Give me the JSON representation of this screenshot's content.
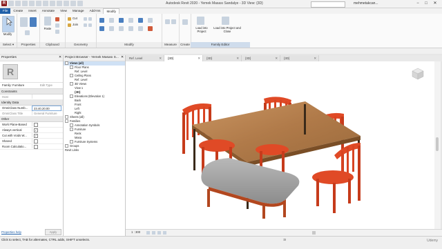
{
  "app": {
    "title": "Autodesk Revit 2020 - Yemek Masası Sandalye - 3D View: {3D}",
    "user": "mehmetakcan...",
    "window_controls": [
      "−",
      "□",
      "✕"
    ]
  },
  "ribbon_tabs": [
    {
      "label": "File"
    },
    {
      "label": "Create"
    },
    {
      "label": "Insert"
    },
    {
      "label": "Annotate"
    },
    {
      "label": "View"
    },
    {
      "label": "Manage"
    },
    {
      "label": "Add-Ins"
    },
    {
      "label": "Modify"
    }
  ],
  "ribbon": {
    "select_panel_label": "Select ▾",
    "modify_button": "Modify",
    "properties_panel_label": "Properties",
    "clipboard_panel_label": "Clipboard",
    "paste_label": "Paste",
    "geometry_panel_label": "Geometry",
    "cut_label": "Cut",
    "join_label": "Join",
    "modify_panel_label": "Modify",
    "measure_panel_label": "Measure",
    "create_panel_label": "Create",
    "load_into_project_label": "Load into Project",
    "load_into_project_close_label": "Load into Project and Close",
    "family_editor_label": "Family Editor"
  },
  "properties": {
    "header": "Properties",
    "close": "✕",
    "type_selector": "Family: Furniture",
    "edit_type": "Edit Type",
    "sections": {
      "constraints": "Constraints",
      "identity": "Identity Data",
      "other": "Other"
    },
    "constraints_rows": [
      {
        "name": "Host",
        "value": ""
      }
    ],
    "identity_rows": [
      {
        "name": "OmniClass Numb...",
        "value": "23.40.20.00"
      },
      {
        "name": "OmniClass Title",
        "value": "General Furniture"
      }
    ],
    "other_rows": [
      {
        "name": "Work Plane-Based",
        "checked": false
      },
      {
        "name": "Always vertical",
        "checked": true
      },
      {
        "name": "Cut with Voids W...",
        "checked": true
      },
      {
        "name": "Shared",
        "checked": false
      },
      {
        "name": "Room Calculatio...",
        "checked": false
      }
    ],
    "help_link": "Properties help",
    "apply_button": "Apply"
  },
  "project_browser": {
    "header": "Project Browser - Yemek Masası S...",
    "close": "✕",
    "items": [
      {
        "label": "Views (all)",
        "level": 0,
        "exp": true,
        "bold": true
      },
      {
        "label": "Floor Plans",
        "level": 1,
        "exp": true
      },
      {
        "label": "Ref. Level",
        "level": 2
      },
      {
        "label": "Ceiling Plans",
        "level": 1,
        "exp": true
      },
      {
        "label": "Ref. Level",
        "level": 2
      },
      {
        "label": "3D Views",
        "level": 1,
        "exp": true
      },
      {
        "label": "View 1",
        "level": 2
      },
      {
        "label": "{3D}",
        "level": 2,
        "bold": true
      },
      {
        "label": "Elevations (Elevation 1)",
        "level": 1,
        "exp": true
      },
      {
        "label": "Back",
        "level": 2
      },
      {
        "label": "Front",
        "level": 2
      },
      {
        "label": "Left",
        "level": 2
      },
      {
        "label": "Right",
        "level": 2
      },
      {
        "label": "Sheets (all)",
        "level": 0,
        "exp": true
      },
      {
        "label": "Families",
        "level": 0,
        "exp": true
      },
      {
        "label": "Annotation Symbols",
        "level": 1,
        "exp": true
      },
      {
        "label": "Furniture",
        "level": 1,
        "exp": true
      },
      {
        "label": "Renk",
        "level": 2
      },
      {
        "label": "Masa",
        "level": 2
      },
      {
        "label": "Furniture Systems",
        "level": 1,
        "exp": true
      },
      {
        "label": "Groups",
        "level": 0,
        "exp": true
      },
      {
        "label": "Revit Links",
        "level": 0
      }
    ]
  },
  "view_tabs": [
    {
      "label": "Ref. Level",
      "active": false
    },
    {
      "label": "{3D}",
      "active": true
    },
    {
      "label": "{3D}",
      "active": false
    },
    {
      "label": "{3D}",
      "active": false
    },
    {
      "label": "{3D}",
      "active": false
    }
  ],
  "view_control": {
    "scale": "1 : 300"
  },
  "status": {
    "text": "Click to select, TAB for alternates, CTRL adds, SHIFT unselects.",
    "zero": ":0",
    "watermark": "Udemy"
  },
  "colors": {
    "accent": "#1f5fa8",
    "table_top": "#b98353",
    "chair": "#e04a26",
    "bench_cushion": "#a7a7a7"
  }
}
